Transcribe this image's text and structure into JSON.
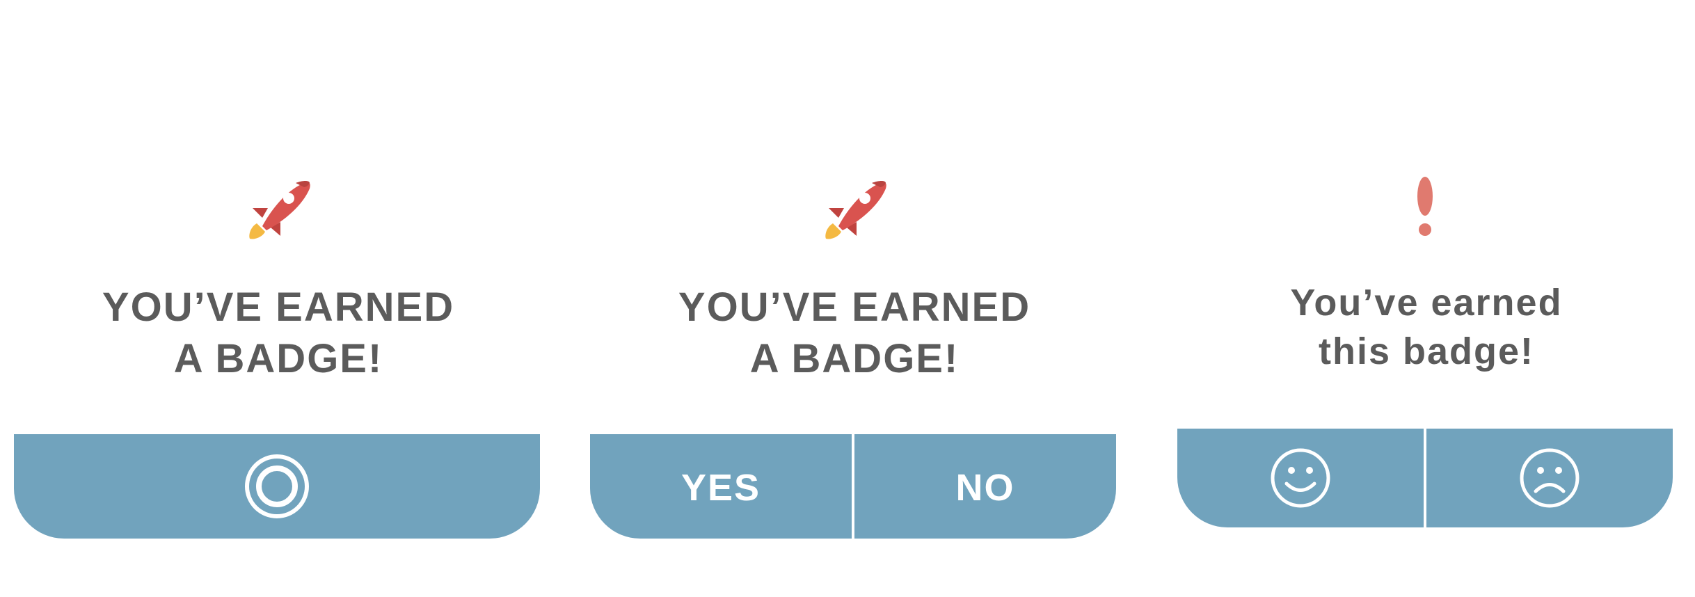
{
  "colors": {
    "background": "#ffffff",
    "text": "#5b5b5b",
    "bar": "#71a3bd",
    "bar_text": "#ffffff",
    "rocket": "#d9534f",
    "flame": "#f4b942",
    "alert": "#e07a6f"
  },
  "cards": [
    {
      "icon": "rocket-icon",
      "title_line1": "YOU’VE EARNED",
      "title_line2": "A BADGE!",
      "buttons": [
        {
          "icon": "circle-ok-icon"
        }
      ]
    },
    {
      "icon": "rocket-icon",
      "title_line1": "YOU’VE EARNED",
      "title_line2": "A BADGE!",
      "buttons": [
        {
          "label": "YES"
        },
        {
          "label": "NO"
        }
      ]
    },
    {
      "icon": "exclamation-icon",
      "title_line1": "You’ve earned",
      "title_line2": "this badge!",
      "buttons": [
        {
          "icon": "smiley-icon"
        },
        {
          "icon": "frowny-icon"
        }
      ]
    }
  ]
}
